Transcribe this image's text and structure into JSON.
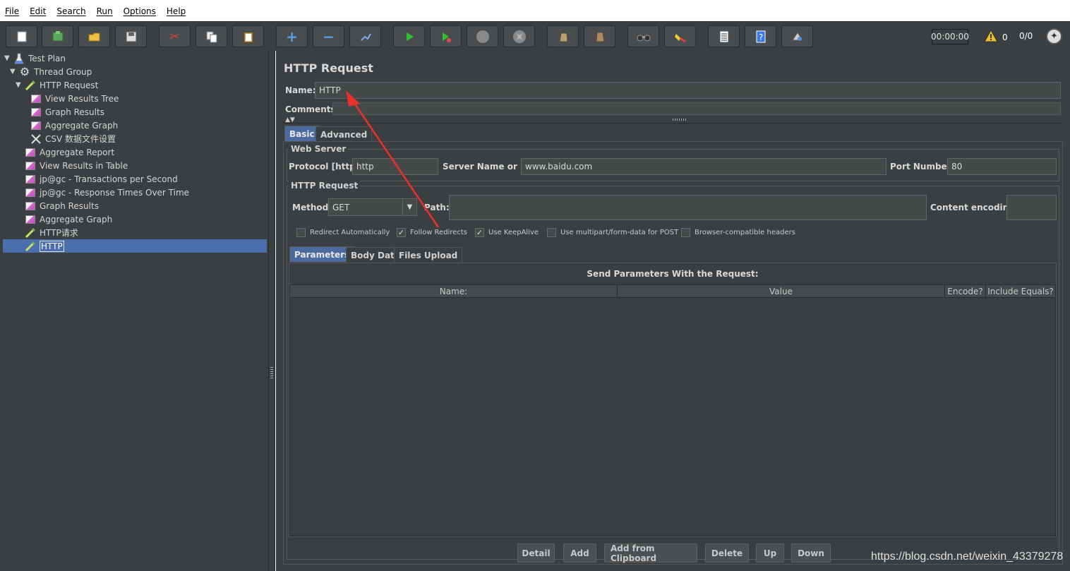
{
  "menu": [
    "File",
    "Edit",
    "Search",
    "Run",
    "Options",
    "Help"
  ],
  "toolbar": {
    "buttons": [
      {
        "name": "new-icon"
      },
      {
        "name": "templates-icon"
      },
      {
        "name": "open-icon"
      },
      {
        "name": "save-icon"
      },
      {
        "name": "cut-icon"
      },
      {
        "name": "copy-icon"
      },
      {
        "name": "paste-icon"
      },
      {
        "name": "expand-icon"
      },
      {
        "name": "collapse-icon"
      },
      {
        "name": "toggle-icon"
      },
      {
        "name": "start-icon"
      },
      {
        "name": "start-no-pauses-icon"
      },
      {
        "name": "stop-icon"
      },
      {
        "name": "shutdown-icon"
      },
      {
        "name": "remote-start-icon"
      },
      {
        "name": "remote-stop-icon"
      },
      {
        "name": "search-icon"
      },
      {
        "name": "clear-icon"
      },
      {
        "name": "function-helper-icon"
      },
      {
        "name": "help-icon"
      },
      {
        "name": "remote-icon"
      }
    ],
    "timer": "00:00:00",
    "warnings": "0",
    "threads": "0/0"
  },
  "tree": {
    "nodes": [
      {
        "label": "Test Plan",
        "icon": "test-plan-icon",
        "expanded": true
      },
      {
        "label": "Thread Group",
        "icon": "thread-group-icon",
        "expanded": true
      },
      {
        "label": "HTTP Request",
        "icon": "sampler-icon",
        "expanded": true
      },
      {
        "label": "View Results Tree",
        "icon": "graph-icon"
      },
      {
        "label": "Graph Results",
        "icon": "graph-icon"
      },
      {
        "label": "Aggregate Graph",
        "icon": "graph-icon"
      },
      {
        "label": "CSV 数据文件设置",
        "icon": "config-icon"
      },
      {
        "label": "Aggregate Report",
        "icon": "graph-icon"
      },
      {
        "label": "View Results in Table",
        "icon": "graph-icon"
      },
      {
        "label": "jp@gc - Transactions per Second",
        "icon": "graph-icon"
      },
      {
        "label": "jp@gc - Response Times Over Time",
        "icon": "graph-icon"
      },
      {
        "label": "Graph Results",
        "icon": "graph-icon"
      },
      {
        "label": "Aggregate Graph",
        "icon": "graph-icon"
      },
      {
        "label": "HTTP请求",
        "icon": "sampler-icon"
      },
      {
        "label": "HTTP",
        "icon": "sampler-icon",
        "selected": true
      }
    ]
  },
  "panel": {
    "title": "HTTP Request",
    "name_label": "Name:",
    "name_value": "HTTP",
    "comments_label": "Comments:",
    "tabs": [
      "Basic",
      "Advanced"
    ],
    "active_tab": "Basic",
    "web_server": {
      "title": "Web Server",
      "protocol_label": "Protocol [http]:",
      "protocol_value": "http",
      "server_label": "Server Name or IP:",
      "server_value": "www.baidu.com",
      "port_label": "Port Number:",
      "port_value": "80"
    },
    "http_request": {
      "title": "HTTP Request",
      "method_label": "Method:",
      "method_value": "GET",
      "path_label": "Path:",
      "path_value": "",
      "encoding_label": "Content encoding:",
      "encoding_value": ""
    },
    "options": [
      {
        "label": "Redirect Automatically",
        "checked": false
      },
      {
        "label": "Follow Redirects",
        "checked": true
      },
      {
        "label": "Use KeepAlive",
        "checked": true
      },
      {
        "label": "Use multipart/form-data for POST",
        "checked": false
      },
      {
        "label": "Browser-compatible headers",
        "checked": false
      }
    ],
    "param_tabs": [
      "Parameters",
      "Body Data",
      "Files Upload"
    ],
    "active_param_tab": "Parameters",
    "params_heading": "Send Parameters With the Request:",
    "table_columns": [
      "Name:",
      "Value",
      "Encode?",
      "Include Equals?"
    ],
    "table_rows": [],
    "buttons": [
      "Detail",
      "Add",
      "Add from Clipboard",
      "Delete",
      "Up",
      "Down"
    ]
  },
  "watermark": "https://blog.csdn.net/weixin_43379278",
  "colors": {
    "background": "#3c3f41",
    "selection": "#4b6eaf",
    "annotation_arrow": "#e8302c"
  }
}
